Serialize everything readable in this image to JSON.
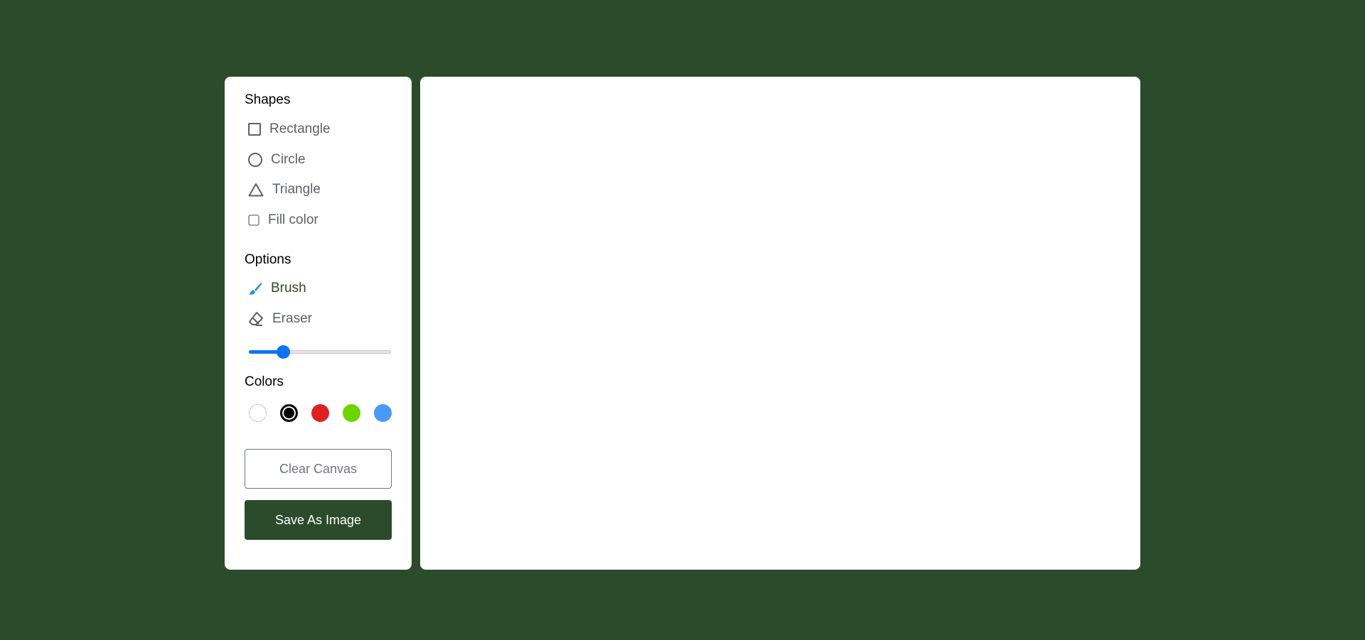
{
  "sidebar": {
    "shapes_title": "Shapes",
    "shapes": [
      {
        "label": "Rectangle",
        "icon": "rectangle-icon"
      },
      {
        "label": "Circle",
        "icon": "circle-icon"
      },
      {
        "label": "Triangle",
        "icon": "triangle-icon"
      }
    ],
    "fill_color_label": "Fill color",
    "fill_color_checked": false,
    "options_title": "Options",
    "options": [
      {
        "label": "Brush",
        "icon": "brush-icon",
        "active": true
      },
      {
        "label": "Eraser",
        "icon": "eraser-icon",
        "active": false
      }
    ],
    "brush_size": {
      "min": 1,
      "max": 30,
      "value": 5
    },
    "colors_title": "Colors",
    "colors": [
      "#ffffff",
      "#000000",
      "#e02020",
      "#6dd400",
      "#4a98f7"
    ],
    "selected_color": "#000000",
    "clear_label": "Clear Canvas",
    "save_label": "Save As Image"
  },
  "theme": {
    "background": "#2b4b2b",
    "accent": "#0a74f0"
  }
}
